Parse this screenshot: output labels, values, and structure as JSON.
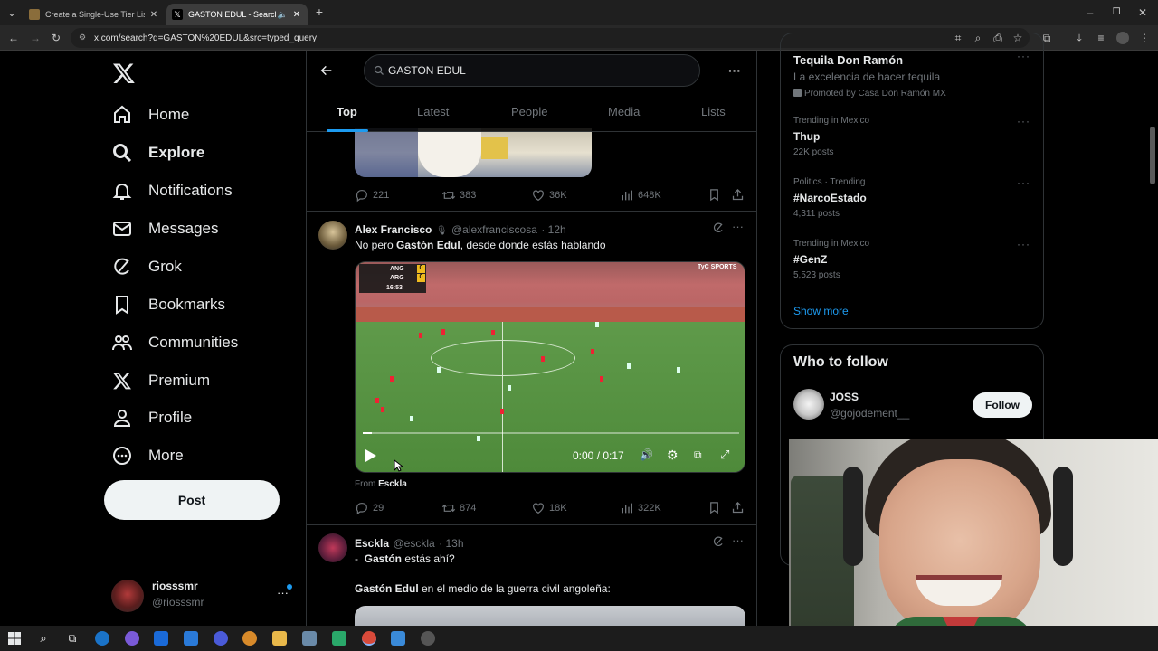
{
  "browser": {
    "tabs": [
      {
        "title": "Create a Single-Use Tier List (Fr",
        "active": false
      },
      {
        "title": "GASTON EDUL - Search / X",
        "active": true
      }
    ],
    "new_tab": "+",
    "url": "x.com/search?q=GASTON%20EDUL&src=typed_query"
  },
  "nav": {
    "items": [
      {
        "label": "Home",
        "icon": "home-icon"
      },
      {
        "label": "Explore",
        "icon": "search-icon"
      },
      {
        "label": "Notifications",
        "icon": "bell-icon"
      },
      {
        "label": "Messages",
        "icon": "mail-icon"
      },
      {
        "label": "Grok",
        "icon": "grok-icon"
      },
      {
        "label": "Bookmarks",
        "icon": "bookmark-icon"
      },
      {
        "label": "Communities",
        "icon": "communities-icon"
      },
      {
        "label": "Premium",
        "icon": "x-logo-icon"
      },
      {
        "label": "Profile",
        "icon": "person-icon"
      },
      {
        "label": "More",
        "icon": "more-circle-icon"
      }
    ],
    "post_label": "Post",
    "account": {
      "name": "riosssmr",
      "handle": "@riosssmr"
    }
  },
  "search": {
    "query": "GASTON EDUL",
    "tabs": [
      "Top",
      "Latest",
      "People",
      "Media",
      "Lists"
    ],
    "active_tab": "Top"
  },
  "tweets": [
    {
      "stats": {
        "replies": "221",
        "reposts": "383",
        "likes": "36K",
        "views": "648K"
      }
    },
    {
      "name": "Alex Francisco",
      "handle": "@alexfranciscosa",
      "time": "· 12h",
      "text_pre": "No pero ",
      "text_bold": "Gastón Edul",
      "text_post": ", desde donde estás hablando",
      "video": {
        "time": "0:00 / 0:17",
        "score_top": "ANG",
        "score_bottom": "ARG",
        "score_a": "0",
        "score_b": "0",
        "clock": "16:53",
        "watermark": "TyC SPORTS"
      },
      "from_label": "From",
      "from_source": "Esckla",
      "stats": {
        "replies": "29",
        "reposts": "874",
        "likes": "18K",
        "views": "322K"
      }
    },
    {
      "name": "Esckla",
      "handle": "@esckla",
      "time": "· 13h",
      "line1_pre": "-  ",
      "line1_bold": "Gastón",
      "line1_post": " estás ahí?",
      "line2_bold": "Gastón Edul",
      "line2_post": " en el medio de la guerra civil angoleña:"
    }
  ],
  "right": {
    "ad": {
      "title": "Tequila Don Ramón",
      "subtitle": "La excelencia de hacer tequila",
      "promoted": "Promoted by Casa Don Ramón MX"
    },
    "trends": [
      {
        "meta": "Trending in Mexico",
        "name": "Thup",
        "count": "22K posts"
      },
      {
        "meta": "Politics · Trending",
        "name": "#NarcoEstado",
        "count": "4,311 posts"
      },
      {
        "meta": "Trending in Mexico",
        "name": "#GenZ",
        "count": "5,523 posts"
      }
    ],
    "show_more": "Show more",
    "who_to_follow": {
      "title": "Who to follow",
      "users": [
        {
          "name": "JOSS",
          "handle": "@gojodement__",
          "button": "Follow"
        }
      ]
    }
  },
  "colors": {
    "accent": "#1d9bf0",
    "background": "#000000",
    "border": "#2f3336",
    "muted": "#71767b"
  }
}
